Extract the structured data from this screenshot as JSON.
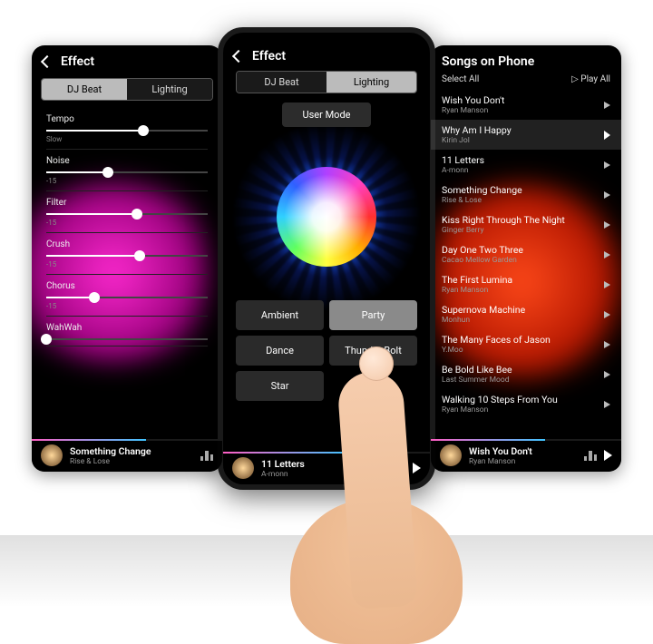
{
  "left": {
    "title": "Effect",
    "tabs": {
      "djbeat": "DJ Beat",
      "lighting": "Lighting",
      "active": "djbeat"
    },
    "sliders": [
      {
        "label": "Tempo",
        "sub": "Slow",
        "pct": 60
      },
      {
        "label": "Noise",
        "sub": "-15",
        "pct": 38
      },
      {
        "label": "Filter",
        "sub": "-15",
        "pct": 56
      },
      {
        "label": "Crush",
        "sub": "-15",
        "pct": 58
      },
      {
        "label": "Chorus",
        "sub": "-15",
        "pct": 30
      },
      {
        "label": "WahWah",
        "sub": "",
        "pct": 0
      }
    ],
    "now_playing": {
      "title": "Something Change",
      "artist": "Rise & Lose"
    }
  },
  "center": {
    "title": "Effect",
    "tabs": {
      "djbeat": "DJ Beat",
      "lighting": "Lighting",
      "active": "lighting"
    },
    "user_mode": "User Mode",
    "modes": [
      {
        "label": "Ambient",
        "selected": false
      },
      {
        "label": "Party",
        "selected": true
      },
      {
        "label": "Dance",
        "selected": false
      },
      {
        "label": "Thunder Bolt",
        "selected": false
      },
      {
        "label": "Star",
        "selected": false
      }
    ],
    "now_playing": {
      "title": "11 Letters",
      "artist": "A-monn"
    }
  },
  "right": {
    "title": "Songs on Phone",
    "select_all": "Select All",
    "play_all": "Play All",
    "songs": [
      {
        "title": "Wish You Don't",
        "artist": "Ryan Manson",
        "hl": false
      },
      {
        "title": "Why Am I Happy",
        "artist": "Kirin Jol",
        "hl": true
      },
      {
        "title": "11 Letters",
        "artist": "A-monn",
        "hl": false
      },
      {
        "title": "Something Change",
        "artist": "Rise & Lose",
        "hl": false
      },
      {
        "title": "Kiss Right Through The Night",
        "artist": "Ginger Berry",
        "hl": false
      },
      {
        "title": "Day One Two Three",
        "artist": "Cacao Mellow Garden",
        "hl": false
      },
      {
        "title": "The First Lumina",
        "artist": "Ryan Manson",
        "hl": false
      },
      {
        "title": "Supernova Machine",
        "artist": "Monhun",
        "hl": false
      },
      {
        "title": "The Many Faces of Jason",
        "artist": "Y.Moo",
        "hl": false
      },
      {
        "title": "Be Bold Like Bee",
        "artist": "Last Summer Mood",
        "hl": false
      },
      {
        "title": "Walking 10 Steps From You",
        "artist": "Ryan Manson",
        "hl": false
      }
    ],
    "now_playing": {
      "title": "Wish You Don't",
      "artist": "Ryan Manson"
    }
  }
}
